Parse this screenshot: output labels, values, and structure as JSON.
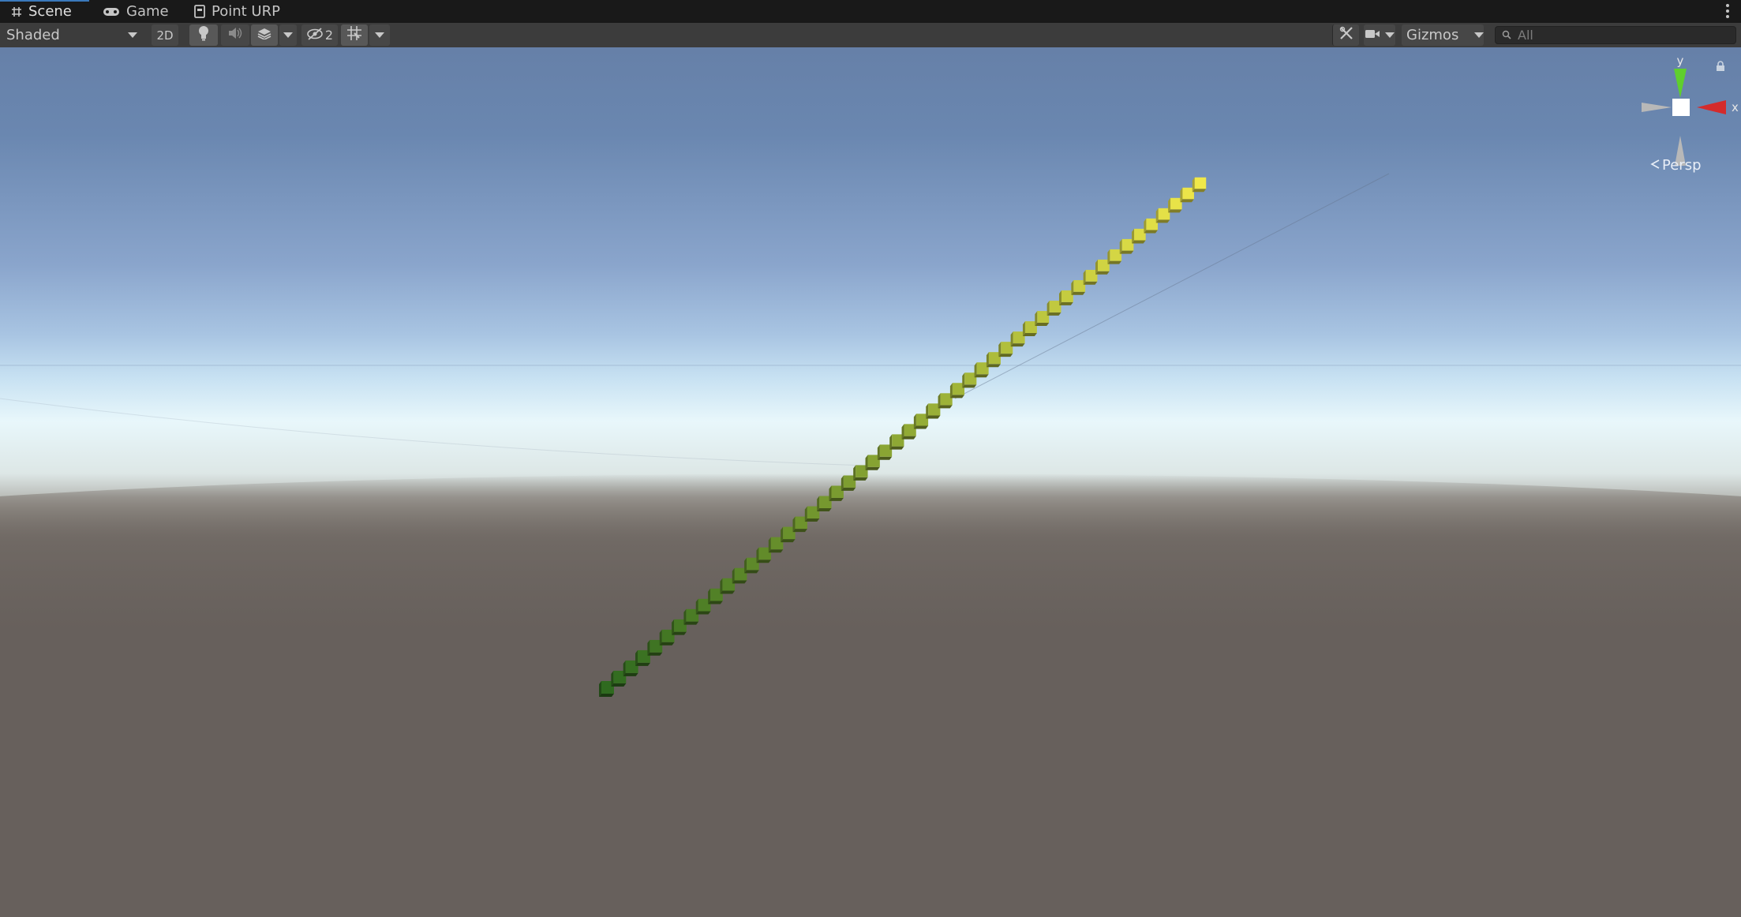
{
  "tabs": [
    {
      "label": "Scene",
      "icon": "grid-hash-icon",
      "active": true
    },
    {
      "label": "Game",
      "icon": "gamepad-icon",
      "active": false
    },
    {
      "label": "Point URP",
      "icon": "document-icon",
      "active": false
    }
  ],
  "toolbar": {
    "draw_mode": "Shaded",
    "two_d_label": "2D",
    "hidden_count": "2",
    "gizmos_label": "Gizmos",
    "search_placeholder": "All"
  },
  "scene": {
    "projection_label": "Persp",
    "axis_labels": {
      "x": "x",
      "y": "y"
    },
    "cube_count": 50,
    "colors": {
      "cube_start": "#2f6a1f",
      "cube_end": "#f0e84a",
      "axis_x": "#d42b2b",
      "axis_y": "#5fcf2d",
      "sky_top": "#6680a8",
      "ground": "#615a56"
    }
  }
}
